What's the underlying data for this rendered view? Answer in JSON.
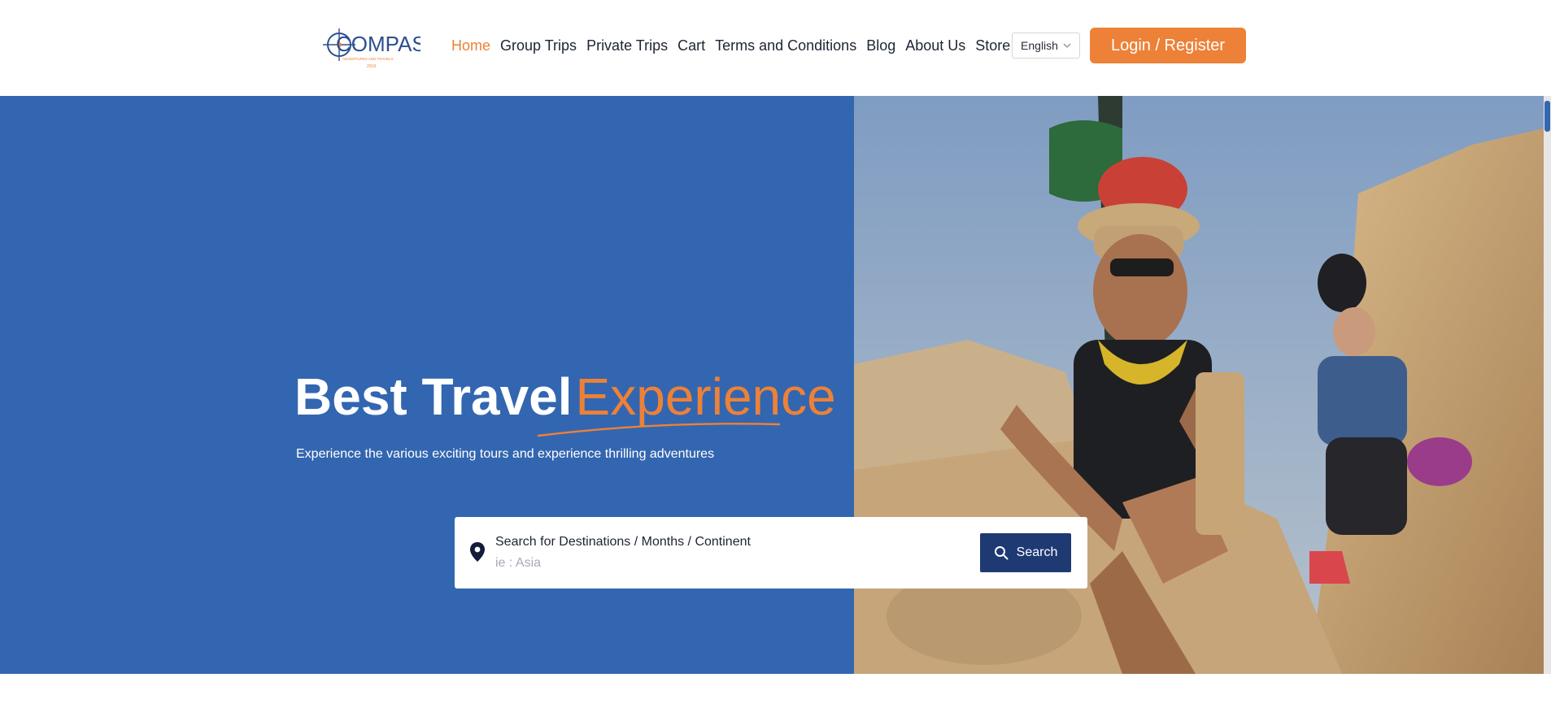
{
  "header": {
    "logo": {
      "text": "COMPASS",
      "tagline": "ADVENTURES AND TRAVELS",
      "year": "2019",
      "icon": "compass-icon"
    },
    "nav": [
      {
        "label": "Home",
        "active": true
      },
      {
        "label": "Group Trips",
        "active": false
      },
      {
        "label": "Private Trips",
        "active": false
      },
      {
        "label": "Cart",
        "active": false
      },
      {
        "label": "Terms and Conditions",
        "active": false
      },
      {
        "label": "Blog",
        "active": false
      },
      {
        "label": "About Us",
        "active": false
      },
      {
        "label": "Store",
        "active": false
      }
    ],
    "language": {
      "selected": "English",
      "icon": "chevron-down-icon"
    },
    "login_label": "Login / Register"
  },
  "hero": {
    "title_part1": "Best Travel",
    "title_part2": "Experience",
    "subtitle": "Experience the various exciting tours and experience thrilling adventures",
    "search": {
      "label": "Search for Destinations / Months / Continent",
      "placeholder": "ie : Asia",
      "value": "",
      "button_label": "Search",
      "pin_icon": "map-pin-icon",
      "button_icon": "search-icon"
    }
  },
  "colors": {
    "accent": "#ed8137",
    "hero_blue": "#3366b0",
    "button_navy": "#1f3a73",
    "text_dark": "#1d2533"
  }
}
